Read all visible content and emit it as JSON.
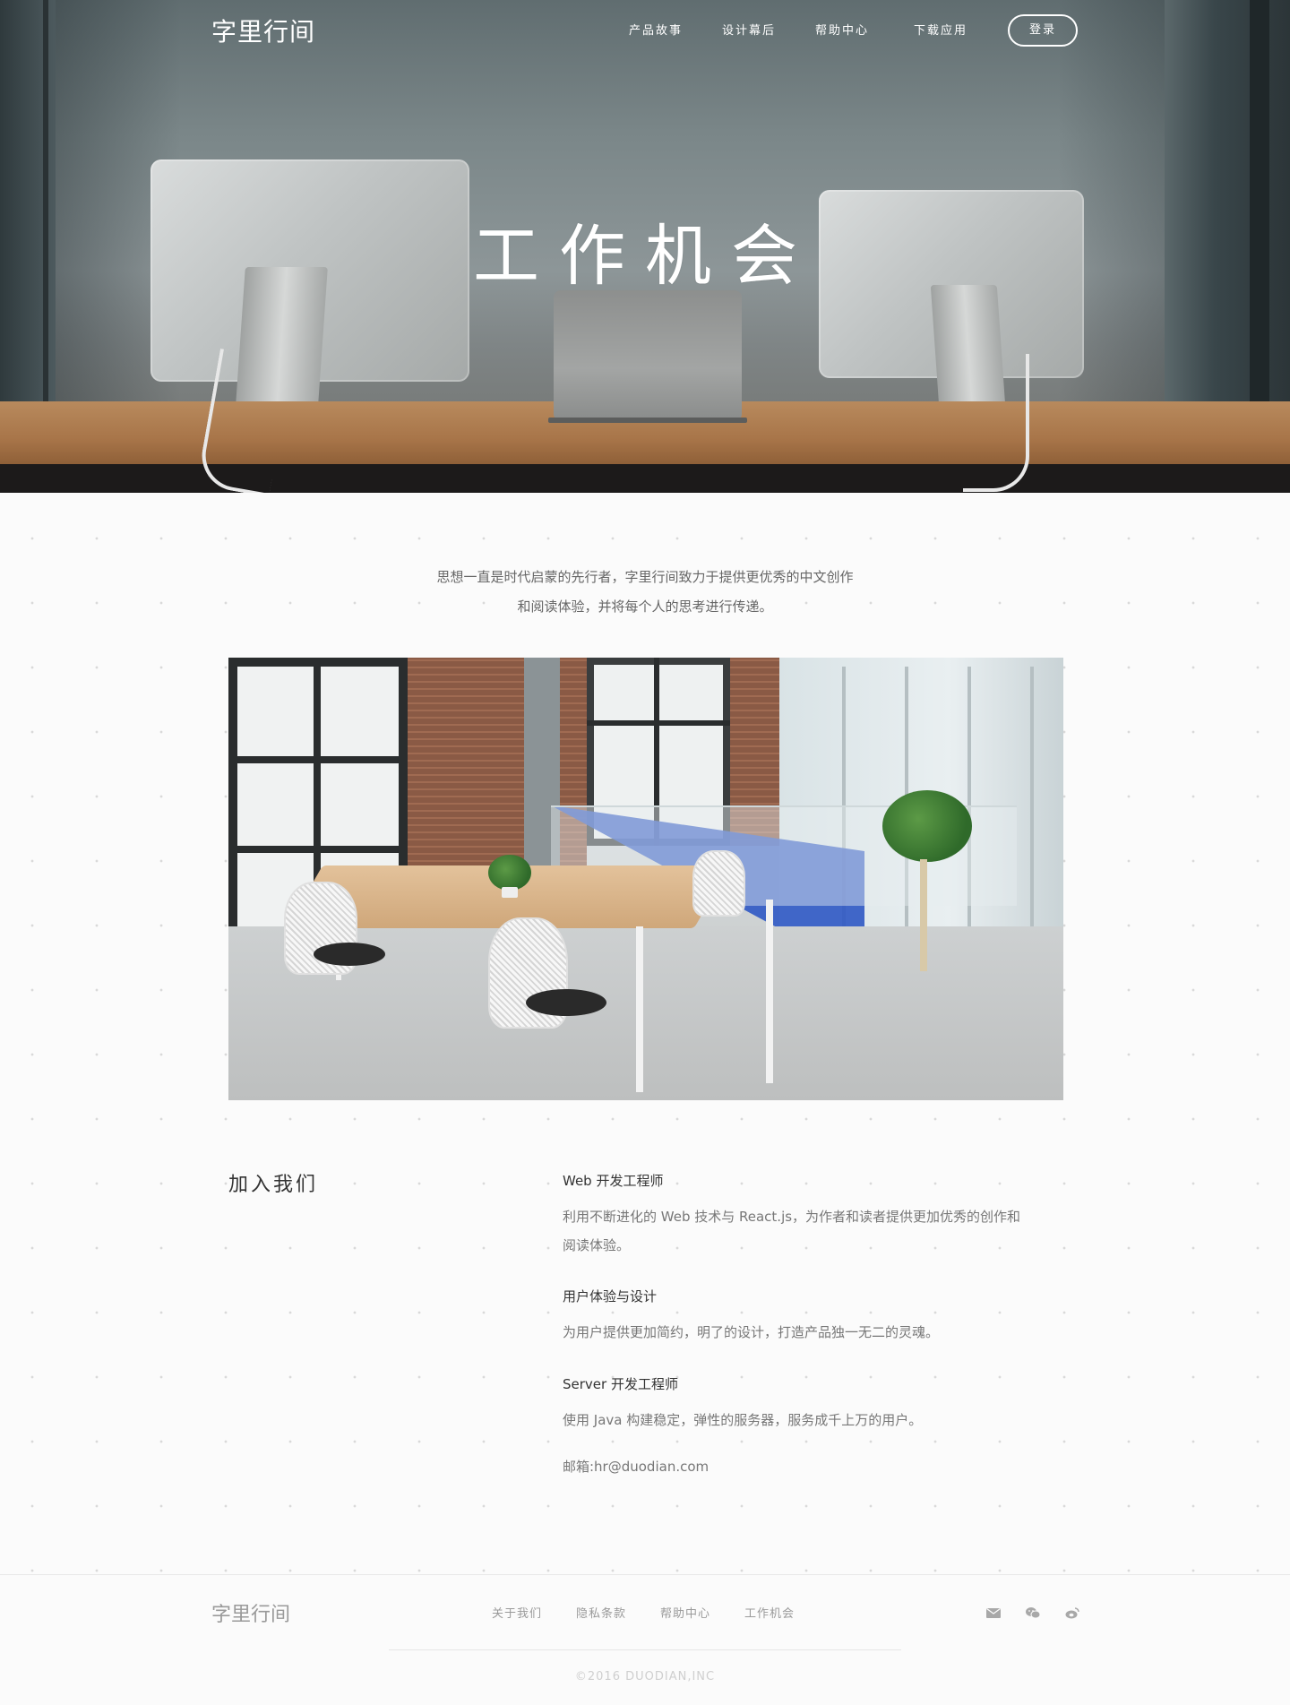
{
  "nav": {
    "logo": "字里行间",
    "links": [
      "产品故事",
      "设计幕后",
      "帮助中心",
      "下载应用"
    ],
    "login_label": "登录"
  },
  "hero": {
    "title": "工作机会"
  },
  "intro": {
    "line1": "思想一直是时代启蒙的先行者，字里行间致力于提供更优秀的中文创作",
    "line2": "和阅读体验，并将每个人的思考进行传递。"
  },
  "join": {
    "title": "加入我们",
    "jobs": [
      {
        "title": "Web 开发工程师",
        "desc_line1": "利用不断进化的 Web 技术与 React.js，为作者和读者提供更加优秀的创作和",
        "desc_line2": "阅读体验。"
      },
      {
        "title": "用户体验与设计",
        "desc_line1": "为用户提供更加简约，明了的设计，打造产品独一无二的灵魂。"
      },
      {
        "title": "Server 开发工程师",
        "desc_line1": "使用 Java 构建稳定，弹性的服务器，服务成千上万的用户。"
      }
    ],
    "email": "邮箱:hr@duodian.com"
  },
  "footer": {
    "logo": "字里行间",
    "links": [
      "关于我们",
      "隐私条款",
      "帮助中心",
      "工作机会"
    ],
    "icons": [
      "mail-icon",
      "wechat-icon",
      "weibo-icon"
    ],
    "copyright": "©2016 DUODIAN,INC"
  }
}
